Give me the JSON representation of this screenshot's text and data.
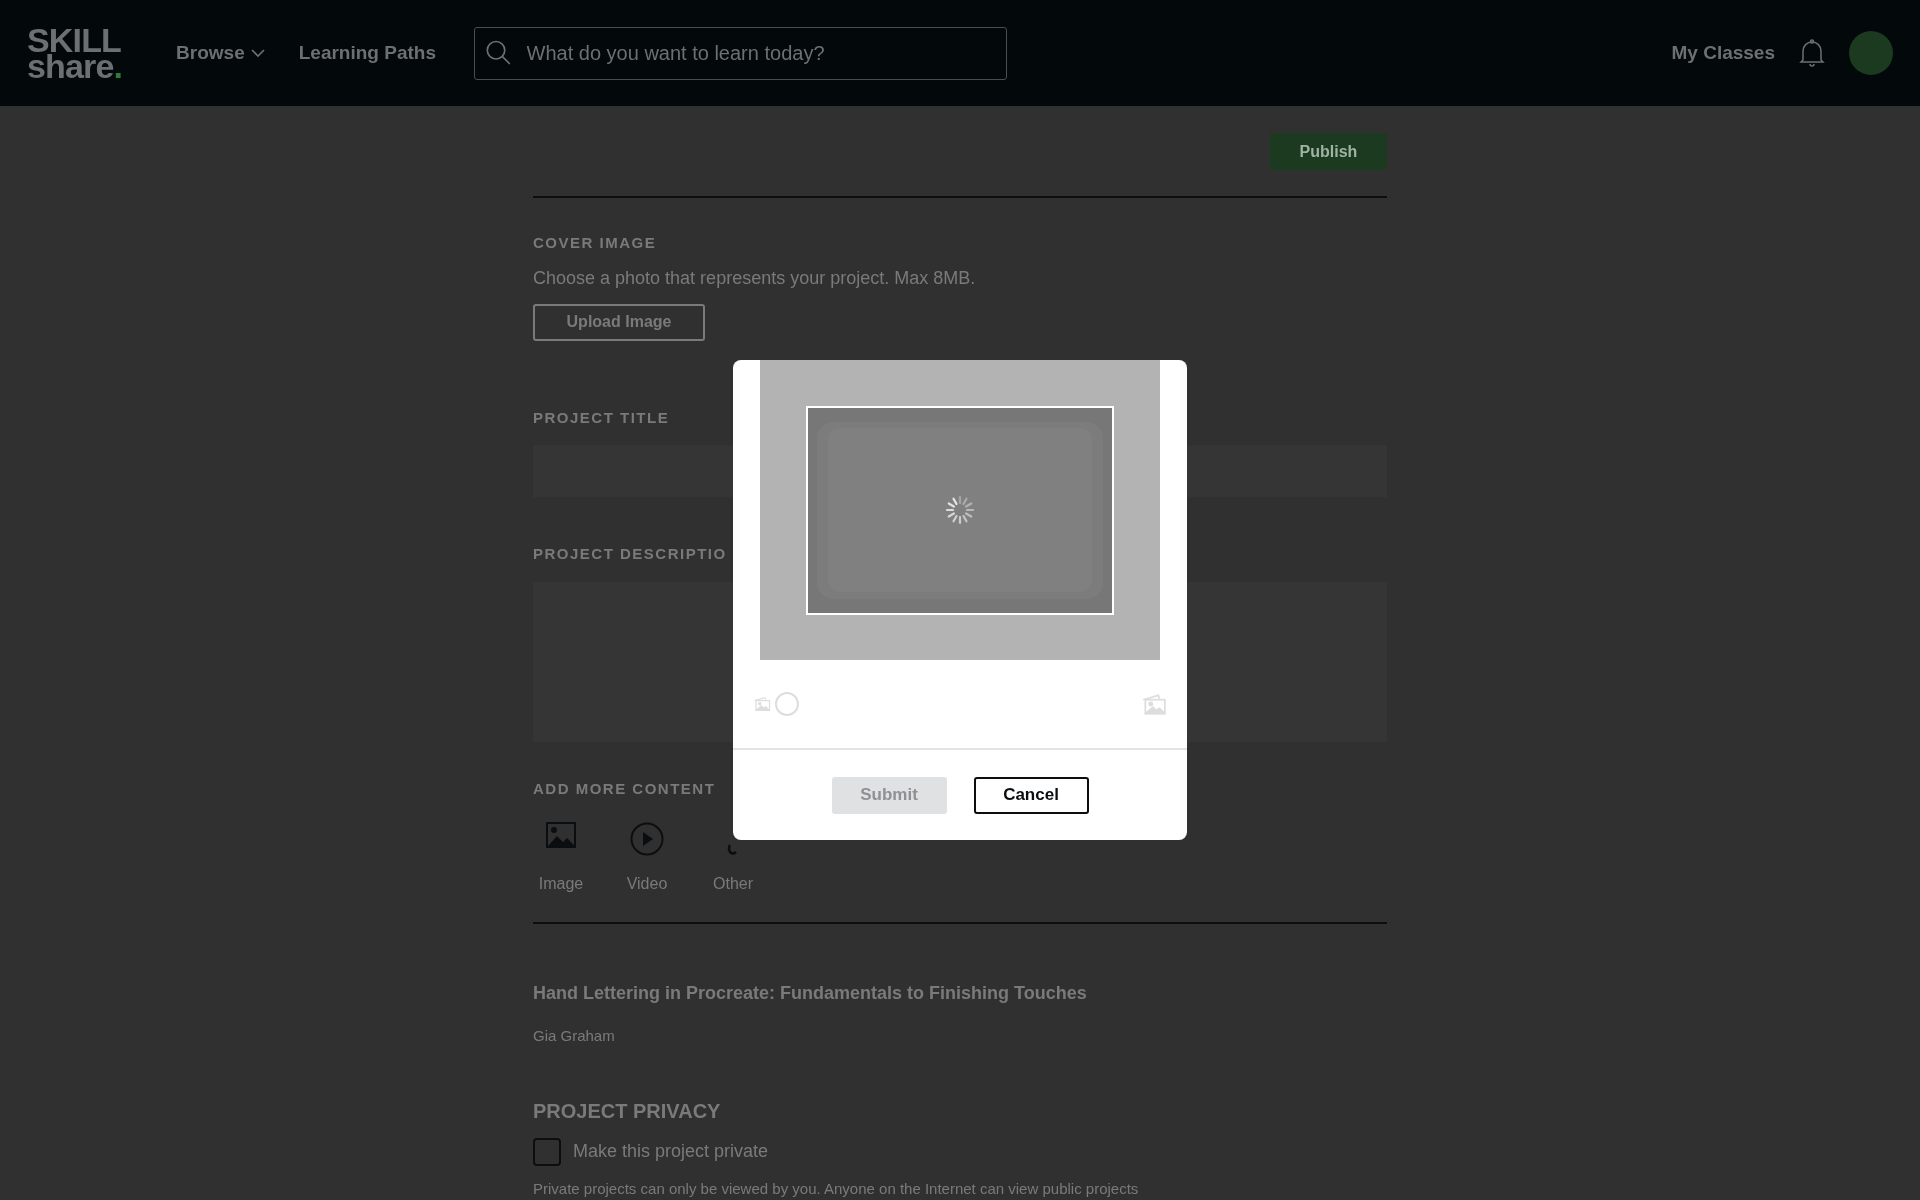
{
  "header": {
    "logo": {
      "top": "SKILL",
      "bottom": "share",
      "dot": "."
    },
    "nav": [
      {
        "label": "Browse",
        "dropdown": true
      },
      {
        "label": "Learning Paths",
        "dropdown": false
      }
    ],
    "search": {
      "placeholder": "What do you want to learn today?"
    },
    "my_classes": "My Classes"
  },
  "form": {
    "publish": "Publish",
    "cover": {
      "label": "COVER IMAGE",
      "hint": "Choose a photo that represents your project. Max 8MB.",
      "button": "Upload Image"
    },
    "title_label": "PROJECT TITLE",
    "description_label": "PROJECT DESCRIPTIO",
    "add_more": {
      "label": "ADD MORE CONTENT",
      "items": [
        {
          "kind": "image",
          "label": "Image"
        },
        {
          "kind": "video",
          "label": "Video"
        },
        {
          "kind": "other",
          "label": "Other"
        }
      ]
    },
    "class": {
      "title": "Hand Lettering in Procreate: Fundamentals to Finishing Touches",
      "teacher": "Gia Graham"
    },
    "privacy": {
      "heading": "PROJECT PRIVACY",
      "checkbox": {
        "label": "Make this project private",
        "checked": false
      },
      "note": "Private projects can only be viewed by you. Anyone on the Internet can view public projects"
    }
  },
  "modal": {
    "loading": true,
    "zoom": {
      "level": 0
    },
    "buttons": [
      {
        "label": "Submit",
        "disabled": true
      },
      {
        "label": "Cancel",
        "disabled": false
      }
    ]
  }
}
